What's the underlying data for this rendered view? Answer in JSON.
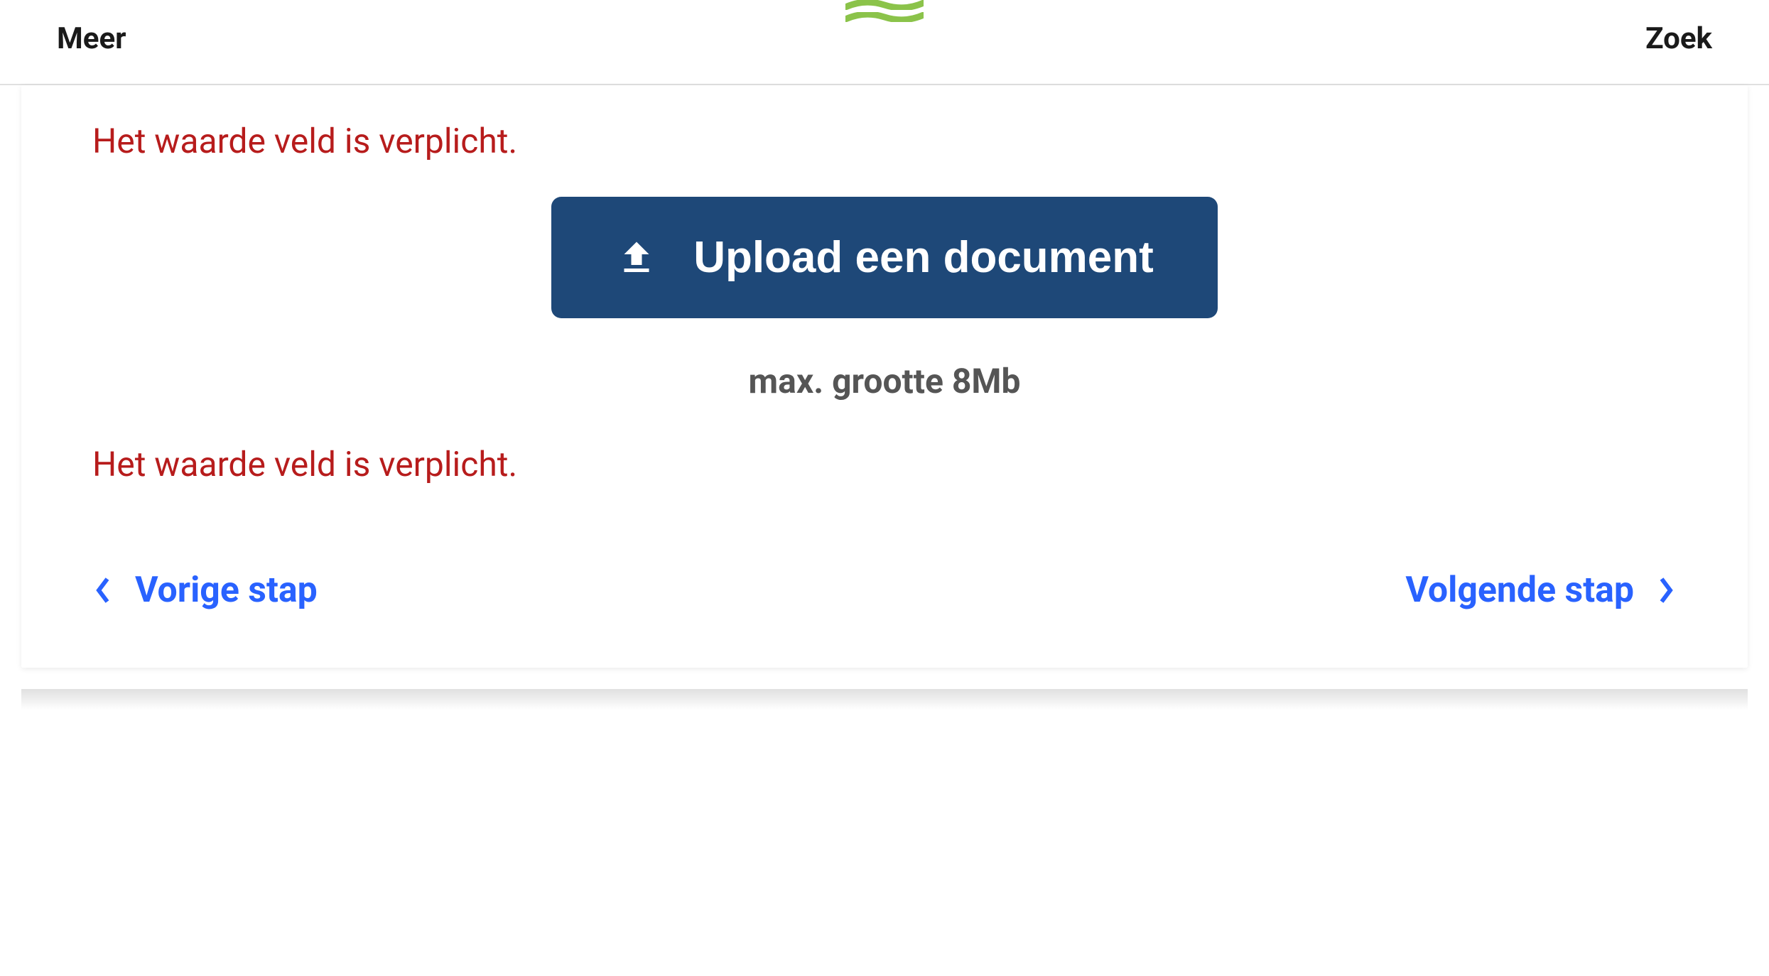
{
  "header": {
    "left_label": "Meer",
    "right_label": "Zoek"
  },
  "form": {
    "error_top": "Het waarde veld is verplicht.",
    "error_bottom": "Het waarde veld is verplicht.",
    "upload_button_label": "Upload een document",
    "size_hint": "max. grootte 8Mb"
  },
  "nav": {
    "prev_label": "Vorige stap",
    "next_label": "Volgende stap"
  },
  "colors": {
    "primary_button": "#1e4878",
    "link": "#2962ff",
    "error": "#b71c1c",
    "logo_green": "#8bc34a"
  }
}
